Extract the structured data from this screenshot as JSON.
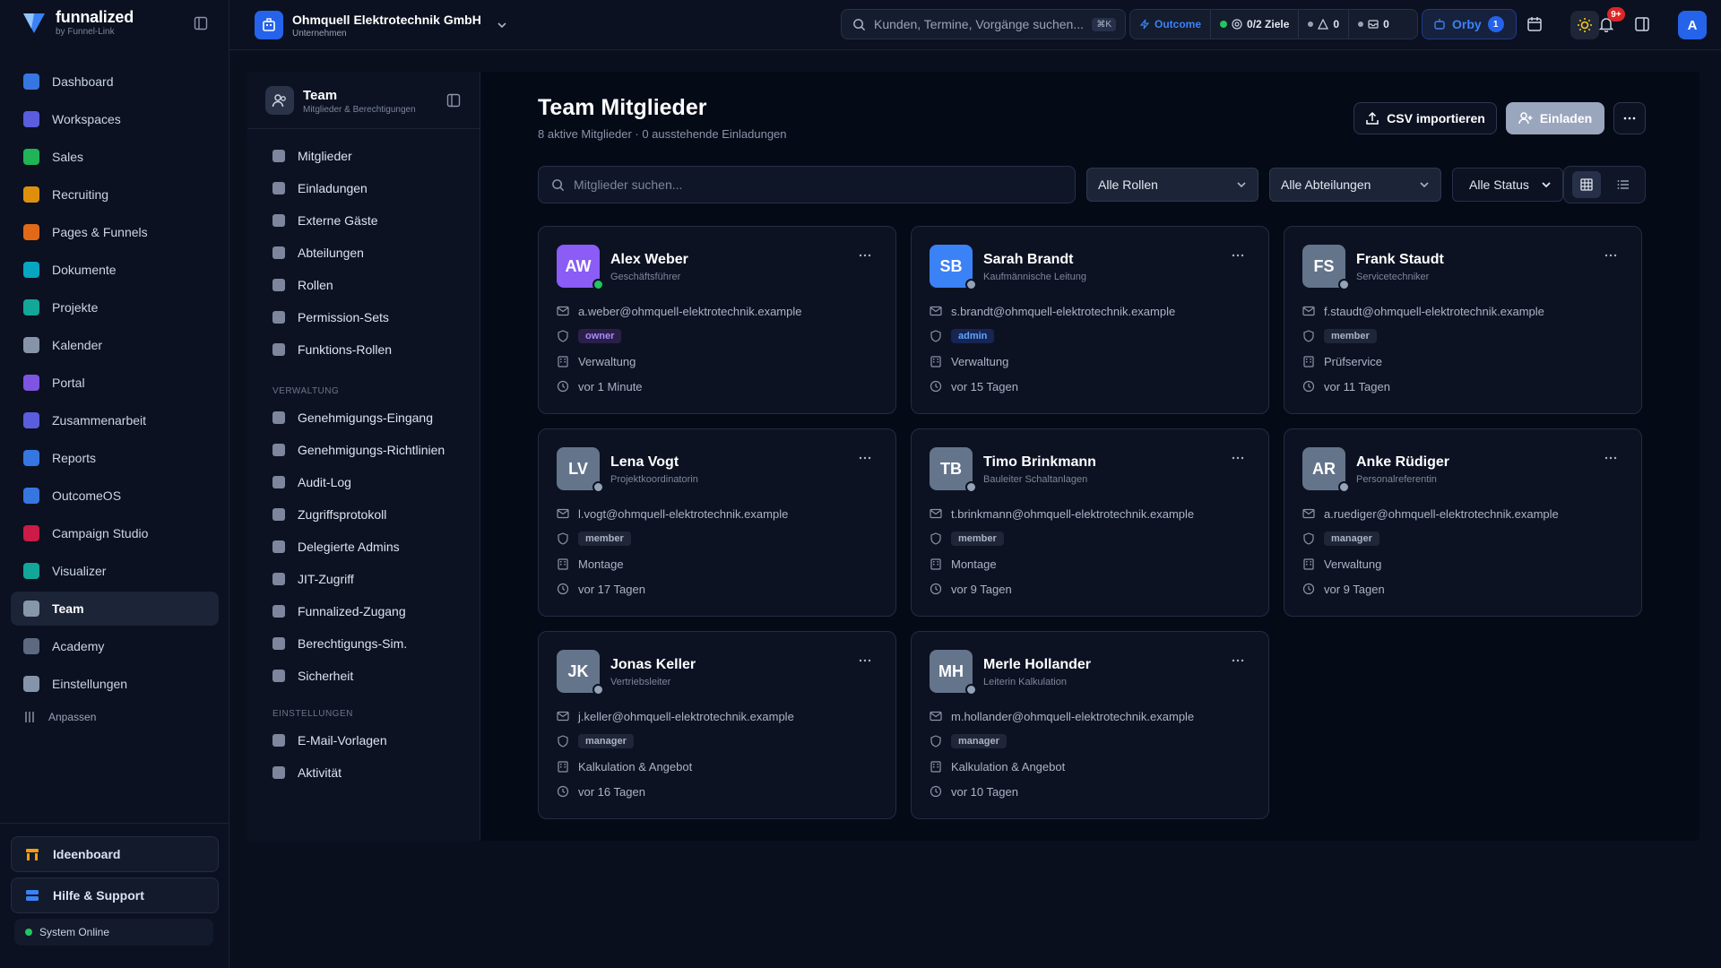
{
  "brand": {
    "name": "funnalized",
    "sub": "by Funnel-Link"
  },
  "sidebar": {
    "items": [
      {
        "label": "Dashboard",
        "icon": "dashboard-icon",
        "color": "#3b82f6"
      },
      {
        "label": "Workspaces",
        "icon": "workspaces-icon",
        "color": "#6366f1"
      },
      {
        "label": "Sales",
        "icon": "sales-icon",
        "color": "#22c55e"
      },
      {
        "label": "Recruiting",
        "icon": "recruiting-icon",
        "color": "#f59e0b"
      },
      {
        "label": "Pages & Funnels",
        "icon": "pages-icon",
        "color": "#f97316"
      },
      {
        "label": "Dokumente",
        "icon": "documents-icon",
        "color": "#06b6d4"
      },
      {
        "label": "Projekte",
        "icon": "projects-icon",
        "color": "#14b8a6"
      },
      {
        "label": "Kalender",
        "icon": "calendar-icon",
        "color": "#94a3b8"
      },
      {
        "label": "Portal",
        "icon": "portal-icon",
        "color": "#8b5cf6"
      },
      {
        "label": "Zusammenarbeit",
        "icon": "collaboration-icon",
        "color": "#6366f1"
      },
      {
        "label": "Reports",
        "icon": "reports-icon",
        "color": "#3b82f6"
      },
      {
        "label": "OutcomeOS",
        "icon": "outcomeos-icon",
        "color": "#3b82f6"
      },
      {
        "label": "Campaign Studio",
        "icon": "flag-icon",
        "color": "#e11d48"
      },
      {
        "label": "Visualizer",
        "icon": "visualizer-icon",
        "color": "#14b8a6"
      },
      {
        "label": "Team",
        "icon": "team-icon",
        "color": "#94a3b8"
      },
      {
        "label": "Academy",
        "icon": "academy-icon",
        "color": "#64748b"
      },
      {
        "label": "Einstellungen",
        "icon": "settings-icon",
        "color": "#94a3b8"
      }
    ],
    "adjust_label": "Anpassen",
    "ideaboard": "Ideenboard",
    "help": "Hilfe & Support",
    "system_status": "System Online"
  },
  "topbar": {
    "company_name": "Ohmquell Elektrotechnik GmbH",
    "company_type": "Unternehmen",
    "search_placeholder": "Kunden, Termine, Vorgänge suchen...",
    "search_shortcut": "⌘K",
    "outcome_label": "Outcome",
    "goals": "0/2 Ziele",
    "warnings": "0",
    "messages": "0",
    "orby_label": "Orby",
    "orby_count": "1",
    "notif_count": "9+",
    "user_initial": "A"
  },
  "subnav": {
    "title": "Team",
    "subtitle": "Mitglieder & Berechtigungen",
    "items": [
      "Mitglieder",
      "Einladungen",
      "Externe Gäste",
      "Abteilungen",
      "Rollen",
      "Permission-Sets",
      "Funktions-Rollen"
    ],
    "section_admin": "VERWALTUNG",
    "admin_items": [
      "Genehmigungs-Eingang",
      "Genehmigungs-Richtlinien",
      "Audit-Log",
      "Zugriffsprotokoll",
      "Delegierte Admins",
      "JIT-Zugriff",
      "Funnalized-Zugang",
      "Berechtigungs-Sim.",
      "Sicherheit"
    ],
    "section_settings": "EINSTELLUNGEN",
    "settings_items": [
      "E-Mail-Vorlagen",
      "Aktivität"
    ]
  },
  "main": {
    "title": "Team Mitglieder",
    "subtitle": "8 aktive Mitglieder · 0 ausstehende Einladungen",
    "csv_button": "CSV importieren",
    "invite_button": "Einladen",
    "search_placeholder": "Mitglieder suchen...",
    "filter_roles": "Alle Rollen",
    "filter_departments": "Alle Abteilungen",
    "filter_status": "Alle Status"
  },
  "members": [
    {
      "initials": "AW",
      "name": "Alex Weber",
      "title": "Geschäftsführer",
      "email": "a.weber@ohmquell-elektrotechnik.example",
      "role": "owner",
      "department": "Verwaltung",
      "last_seen": "vor 1 Minute",
      "avatar_color": "#8b5cf6",
      "online": true
    },
    {
      "initials": "SB",
      "name": "Sarah Brandt",
      "title": "Kaufmännische Leitung",
      "email": "s.brandt@ohmquell-elektrotechnik.example",
      "role": "admin",
      "department": "Verwaltung",
      "last_seen": "vor 15 Tagen",
      "avatar_color": "#3b82f6",
      "online": false
    },
    {
      "initials": "FS",
      "name": "Frank Staudt",
      "title": "Servicetechniker",
      "email": "f.staudt@ohmquell-elektrotechnik.example",
      "role": "member",
      "department": "Prüfservice",
      "last_seen": "vor 11 Tagen",
      "avatar_color": "#64748b",
      "online": false
    },
    {
      "initials": "LV",
      "name": "Lena Vogt",
      "title": "Projektkoordinatorin",
      "email": "l.vogt@ohmquell-elektrotechnik.example",
      "role": "member",
      "department": "Montage",
      "last_seen": "vor 17 Tagen",
      "avatar_color": "#64748b",
      "online": false
    },
    {
      "initials": "TB",
      "name": "Timo Brinkmann",
      "title": "Bauleiter Schaltanlagen",
      "email": "t.brinkmann@ohmquell-elektrotechnik.example",
      "role": "member",
      "department": "Montage",
      "last_seen": "vor 9 Tagen",
      "avatar_color": "#64748b",
      "online": false
    },
    {
      "initials": "AR",
      "name": "Anke Rüdiger",
      "title": "Personalreferentin",
      "email": "a.ruediger@ohmquell-elektrotechnik.example",
      "role": "manager",
      "department": "Verwaltung",
      "last_seen": "vor 9 Tagen",
      "avatar_color": "#64748b",
      "online": false
    },
    {
      "initials": "JK",
      "name": "Jonas Keller",
      "title": "Vertriebsleiter",
      "email": "j.keller@ohmquell-elektrotechnik.example",
      "role": "manager",
      "department": "Kalkulation & Angebot",
      "last_seen": "vor 16 Tagen",
      "avatar_color": "#64748b",
      "online": false
    },
    {
      "initials": "MH",
      "name": "Merle Hollander",
      "title": "Leiterin Kalkulation",
      "email": "m.hollander@ohmquell-elektrotechnik.example",
      "role": "manager",
      "department": "Kalkulation & Angebot",
      "last_seen": "vor 10 Tagen",
      "avatar_color": "#64748b",
      "online": false
    }
  ]
}
